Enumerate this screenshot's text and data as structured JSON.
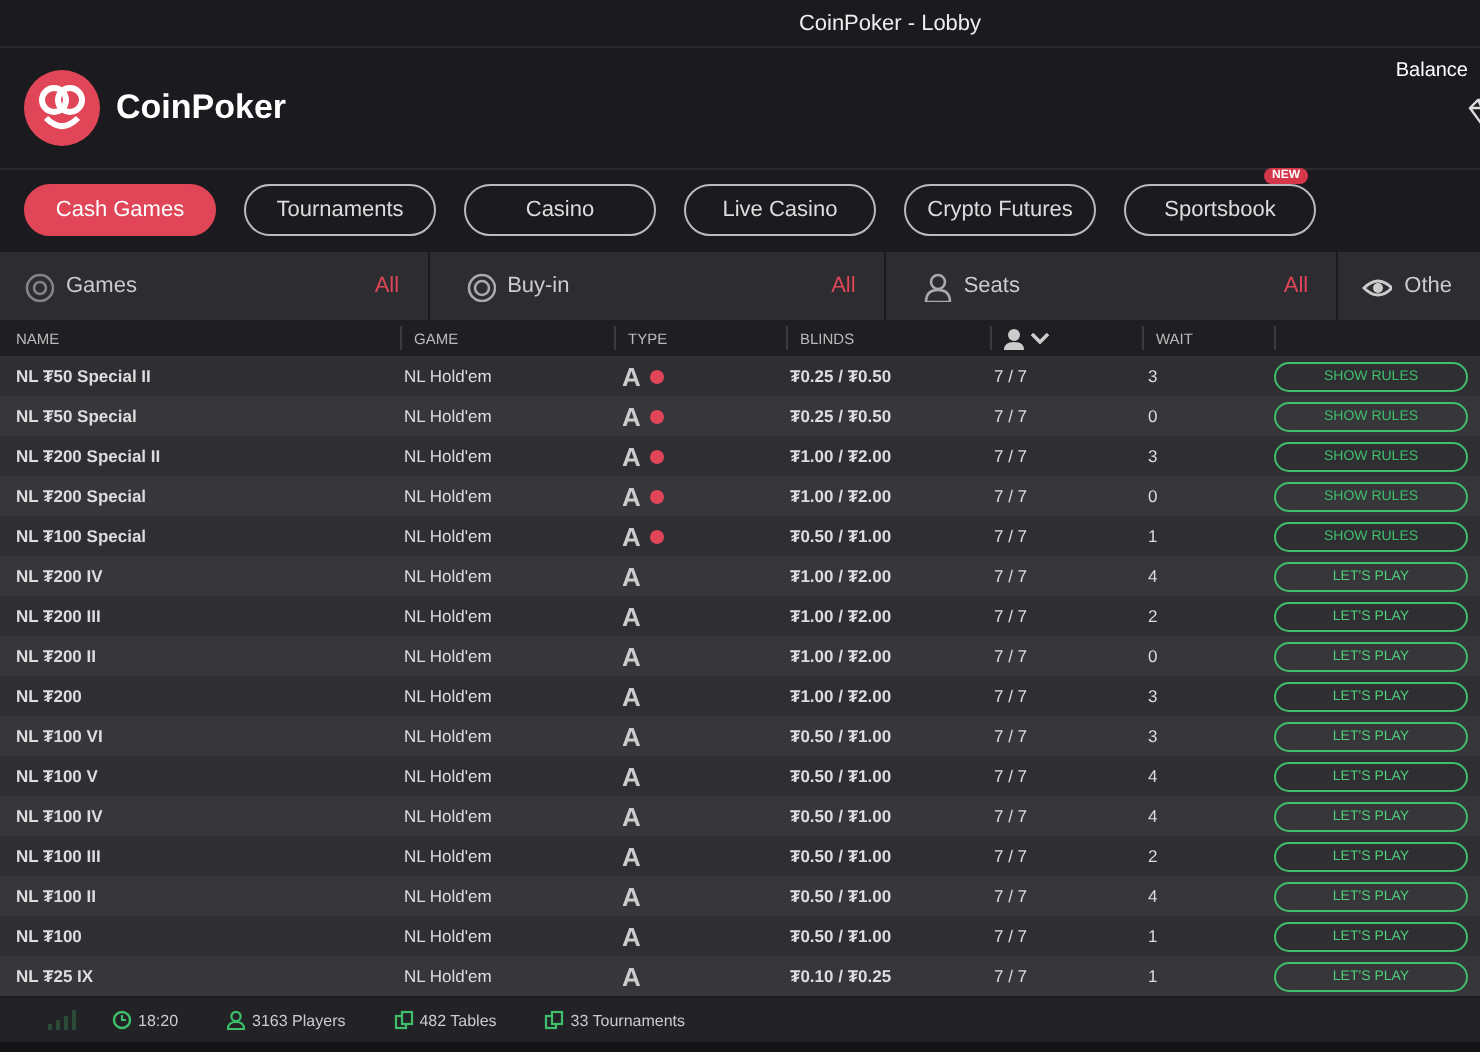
{
  "window": {
    "title": "CoinPoker - Lobby"
  },
  "header": {
    "brand": "CoinPoker",
    "balance_label": "Balance"
  },
  "tabs": [
    {
      "label": "Cash Games",
      "selected": true
    },
    {
      "label": "Tournaments",
      "selected": false
    },
    {
      "label": "Casino",
      "selected": false
    },
    {
      "label": "Live Casino",
      "selected": false
    },
    {
      "label": "Crypto Futures",
      "selected": false
    },
    {
      "label": "Sportsbook",
      "selected": false,
      "badge": "NEW"
    }
  ],
  "filters": [
    {
      "kind": "games",
      "label": "Games",
      "value": "All"
    },
    {
      "kind": "buyin",
      "label": "Buy-in",
      "value": "All"
    },
    {
      "kind": "seats",
      "label": "Seats",
      "value": "All"
    },
    {
      "kind": "other",
      "label": "Othe"
    }
  ],
  "table": {
    "columns": [
      "NAME",
      "GAME",
      "TYPE",
      "BLINDS",
      "",
      "WAIT"
    ],
    "rows": [
      {
        "name": "NL ₮50 Special II",
        "game": "NL  Hold'em",
        "type": "A",
        "restricted": true,
        "blinds": "₮0.25 / ₮0.50",
        "players": "7 / 7",
        "wait": "3",
        "action": {
          "kind": "rules",
          "label": "SHOW RULES"
        }
      },
      {
        "name": "NL ₮50 Special",
        "game": "NL  Hold'em",
        "type": "A",
        "restricted": true,
        "blinds": "₮0.25 / ₮0.50",
        "players": "7 / 7",
        "wait": "0",
        "action": {
          "kind": "rules",
          "label": "SHOW RULES"
        }
      },
      {
        "name": "NL ₮200 Special II",
        "game": "NL  Hold'em",
        "type": "A",
        "restricted": true,
        "blinds": "₮1.00 / ₮2.00",
        "players": "7 / 7",
        "wait": "3",
        "action": {
          "kind": "rules",
          "label": "SHOW RULES"
        }
      },
      {
        "name": "NL ₮200 Special",
        "game": "NL  Hold'em",
        "type": "A",
        "restricted": true,
        "blinds": "₮1.00 / ₮2.00",
        "players": "7 / 7",
        "wait": "0",
        "action": {
          "kind": "rules",
          "label": "SHOW RULES"
        }
      },
      {
        "name": "NL ₮100 Special",
        "game": "NL  Hold'em",
        "type": "A",
        "restricted": true,
        "blinds": "₮0.50 / ₮1.00",
        "players": "7 / 7",
        "wait": "1",
        "action": {
          "kind": "rules",
          "label": "SHOW RULES"
        }
      },
      {
        "name": "NL ₮200 IV",
        "game": "NL  Hold'em",
        "type": "A",
        "restricted": false,
        "blinds": "₮1.00 / ₮2.00",
        "players": "7 / 7",
        "wait": "4",
        "action": {
          "kind": "play",
          "label": "LET'S PLAY"
        }
      },
      {
        "name": "NL ₮200 III",
        "game": "NL  Hold'em",
        "type": "A",
        "restricted": false,
        "blinds": "₮1.00 / ₮2.00",
        "players": "7 / 7",
        "wait": "2",
        "action": {
          "kind": "play",
          "label": "LET'S PLAY"
        }
      },
      {
        "name": "NL ₮200 II",
        "game": "NL  Hold'em",
        "type": "A",
        "restricted": false,
        "blinds": "₮1.00 / ₮2.00",
        "players": "7 / 7",
        "wait": "0",
        "action": {
          "kind": "play",
          "label": "LET'S PLAY"
        }
      },
      {
        "name": "NL ₮200",
        "game": "NL  Hold'em",
        "type": "A",
        "restricted": false,
        "blinds": "₮1.00 / ₮2.00",
        "players": "7 / 7",
        "wait": "3",
        "action": {
          "kind": "play",
          "label": "LET'S PLAY"
        }
      },
      {
        "name": "NL ₮100 VI",
        "game": "NL  Hold'em",
        "type": "A",
        "restricted": false,
        "blinds": "₮0.50 / ₮1.00",
        "players": "7 / 7",
        "wait": "3",
        "action": {
          "kind": "play",
          "label": "LET'S PLAY"
        }
      },
      {
        "name": "NL ₮100 V",
        "game": "NL  Hold'em",
        "type": "A",
        "restricted": false,
        "blinds": "₮0.50 / ₮1.00",
        "players": "7 / 7",
        "wait": "4",
        "action": {
          "kind": "play",
          "label": "LET'S PLAY"
        }
      },
      {
        "name": "NL ₮100 IV",
        "game": "NL  Hold'em",
        "type": "A",
        "restricted": false,
        "blinds": "₮0.50 / ₮1.00",
        "players": "7 / 7",
        "wait": "4",
        "action": {
          "kind": "play",
          "label": "LET'S PLAY"
        }
      },
      {
        "name": "NL ₮100 III",
        "game": "NL  Hold'em",
        "type": "A",
        "restricted": false,
        "blinds": "₮0.50 / ₮1.00",
        "players": "7 / 7",
        "wait": "2",
        "action": {
          "kind": "play",
          "label": "LET'S PLAY"
        }
      },
      {
        "name": "NL ₮100 II",
        "game": "NL  Hold'em",
        "type": "A",
        "restricted": false,
        "blinds": "₮0.50 / ₮1.00",
        "players": "7 / 7",
        "wait": "4",
        "action": {
          "kind": "play",
          "label": "LET'S PLAY"
        }
      },
      {
        "name": "NL ₮100",
        "game": "NL  Hold'em",
        "type": "A",
        "restricted": false,
        "blinds": "₮0.50 / ₮1.00",
        "players": "7 / 7",
        "wait": "1",
        "action": {
          "kind": "play",
          "label": "LET'S PLAY"
        }
      },
      {
        "name": "NL ₮25 IX",
        "game": "NL  Hold'em",
        "type": "A",
        "restricted": false,
        "blinds": "₮0.10 / ₮0.25",
        "players": "7 / 7",
        "wait": "1",
        "action": {
          "kind": "play",
          "label": "LET'S PLAY"
        }
      }
    ]
  },
  "status_bar": [
    {
      "kind": "clock",
      "text": "18:20"
    },
    {
      "kind": "players",
      "text": "3163 Players"
    },
    {
      "kind": "tables",
      "text": "482 Tables"
    },
    {
      "kind": "tournaments",
      "text": "33 Tournaments"
    }
  ]
}
